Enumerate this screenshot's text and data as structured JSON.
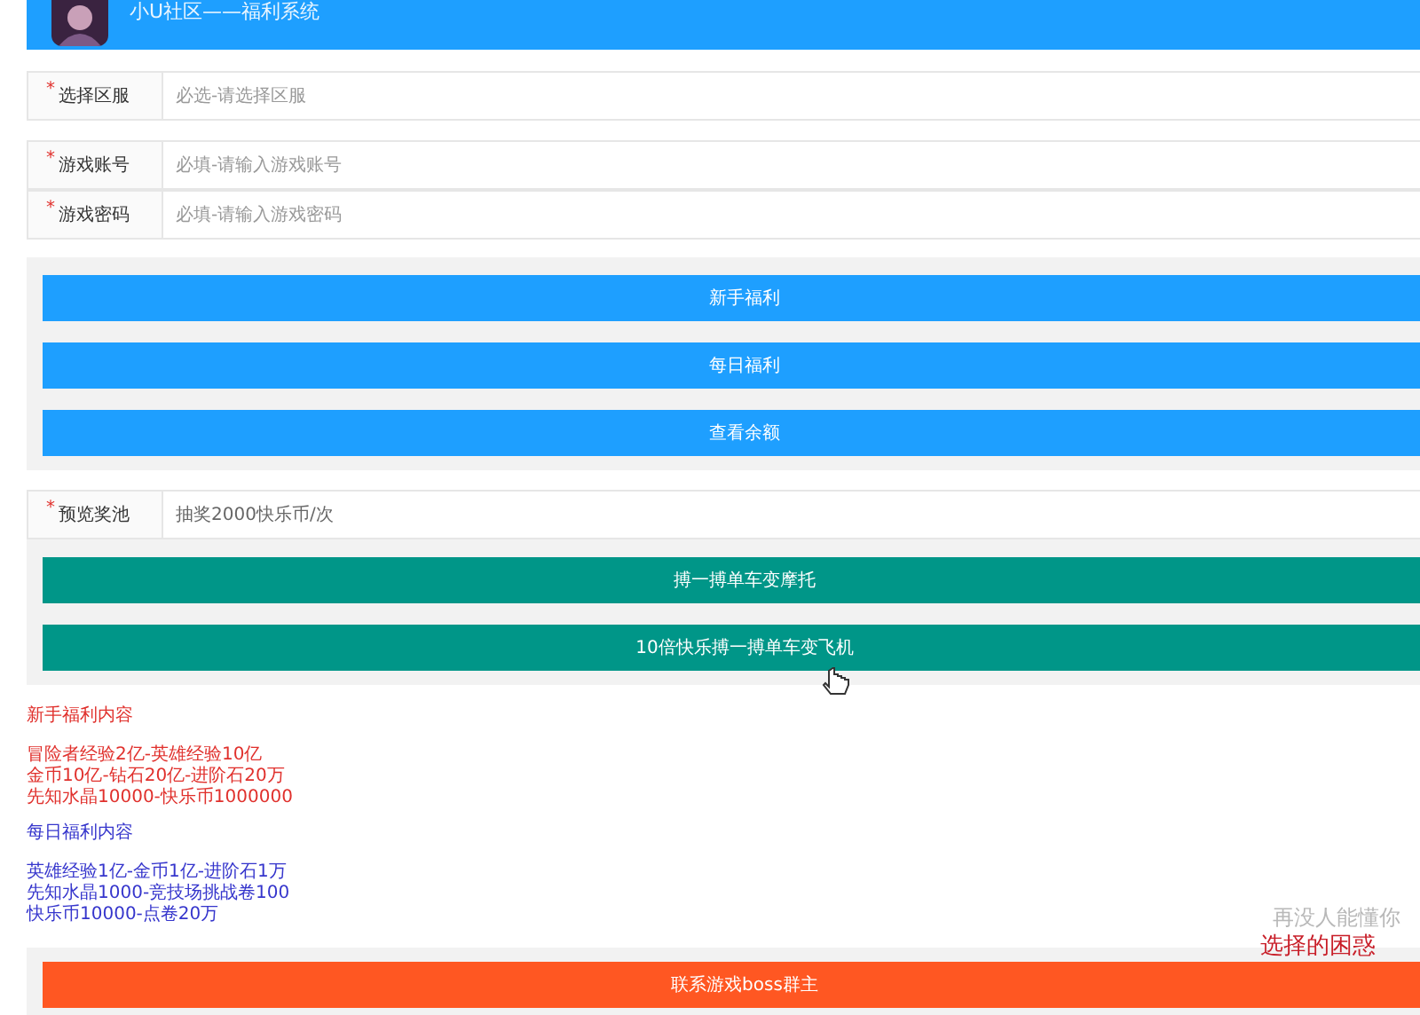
{
  "header": {
    "title": "小U社区——福利系统"
  },
  "server_select": {
    "label": "选择区服",
    "required_mark": "*",
    "placeholder": "必选-请选择区服"
  },
  "account_fields": [
    {
      "label": "游戏账号",
      "required_mark": "*",
      "placeholder": "必填-请输入游戏账号"
    },
    {
      "label": "游戏密码",
      "required_mark": "*",
      "placeholder": "必填-请输入游戏密码"
    }
  ],
  "welfare_buttons": [
    "新手福利",
    "每日福利",
    "查看余额"
  ],
  "pool_select": {
    "label": "预览奖池",
    "required_mark": "*",
    "value": "抽奖2000快乐币/次"
  },
  "draw_buttons": [
    "搏一搏单车变摩托",
    "10倍快乐搏一搏单车变飞机"
  ],
  "info_sections": [
    {
      "title": "新手福利内容",
      "color": "#e0302c",
      "lines": [
        "冒险者经验2亿-英雄经验10亿",
        "金币10亿-钻石20亿-进阶石20万",
        "先知水晶10000-快乐币1000000"
      ]
    },
    {
      "title": "每日福利内容",
      "color": "#3535cc",
      "lines": [
        "英雄经验1亿-金币1亿-进阶石1万",
        "先知水晶1000-竞技场挑战卷100",
        "快乐币10000-点卷20万"
      ]
    }
  ],
  "overlay_texts": [
    "再没人能懂你",
    "选择的困惑"
  ],
  "contact_button": "联系游戏boss群主"
}
